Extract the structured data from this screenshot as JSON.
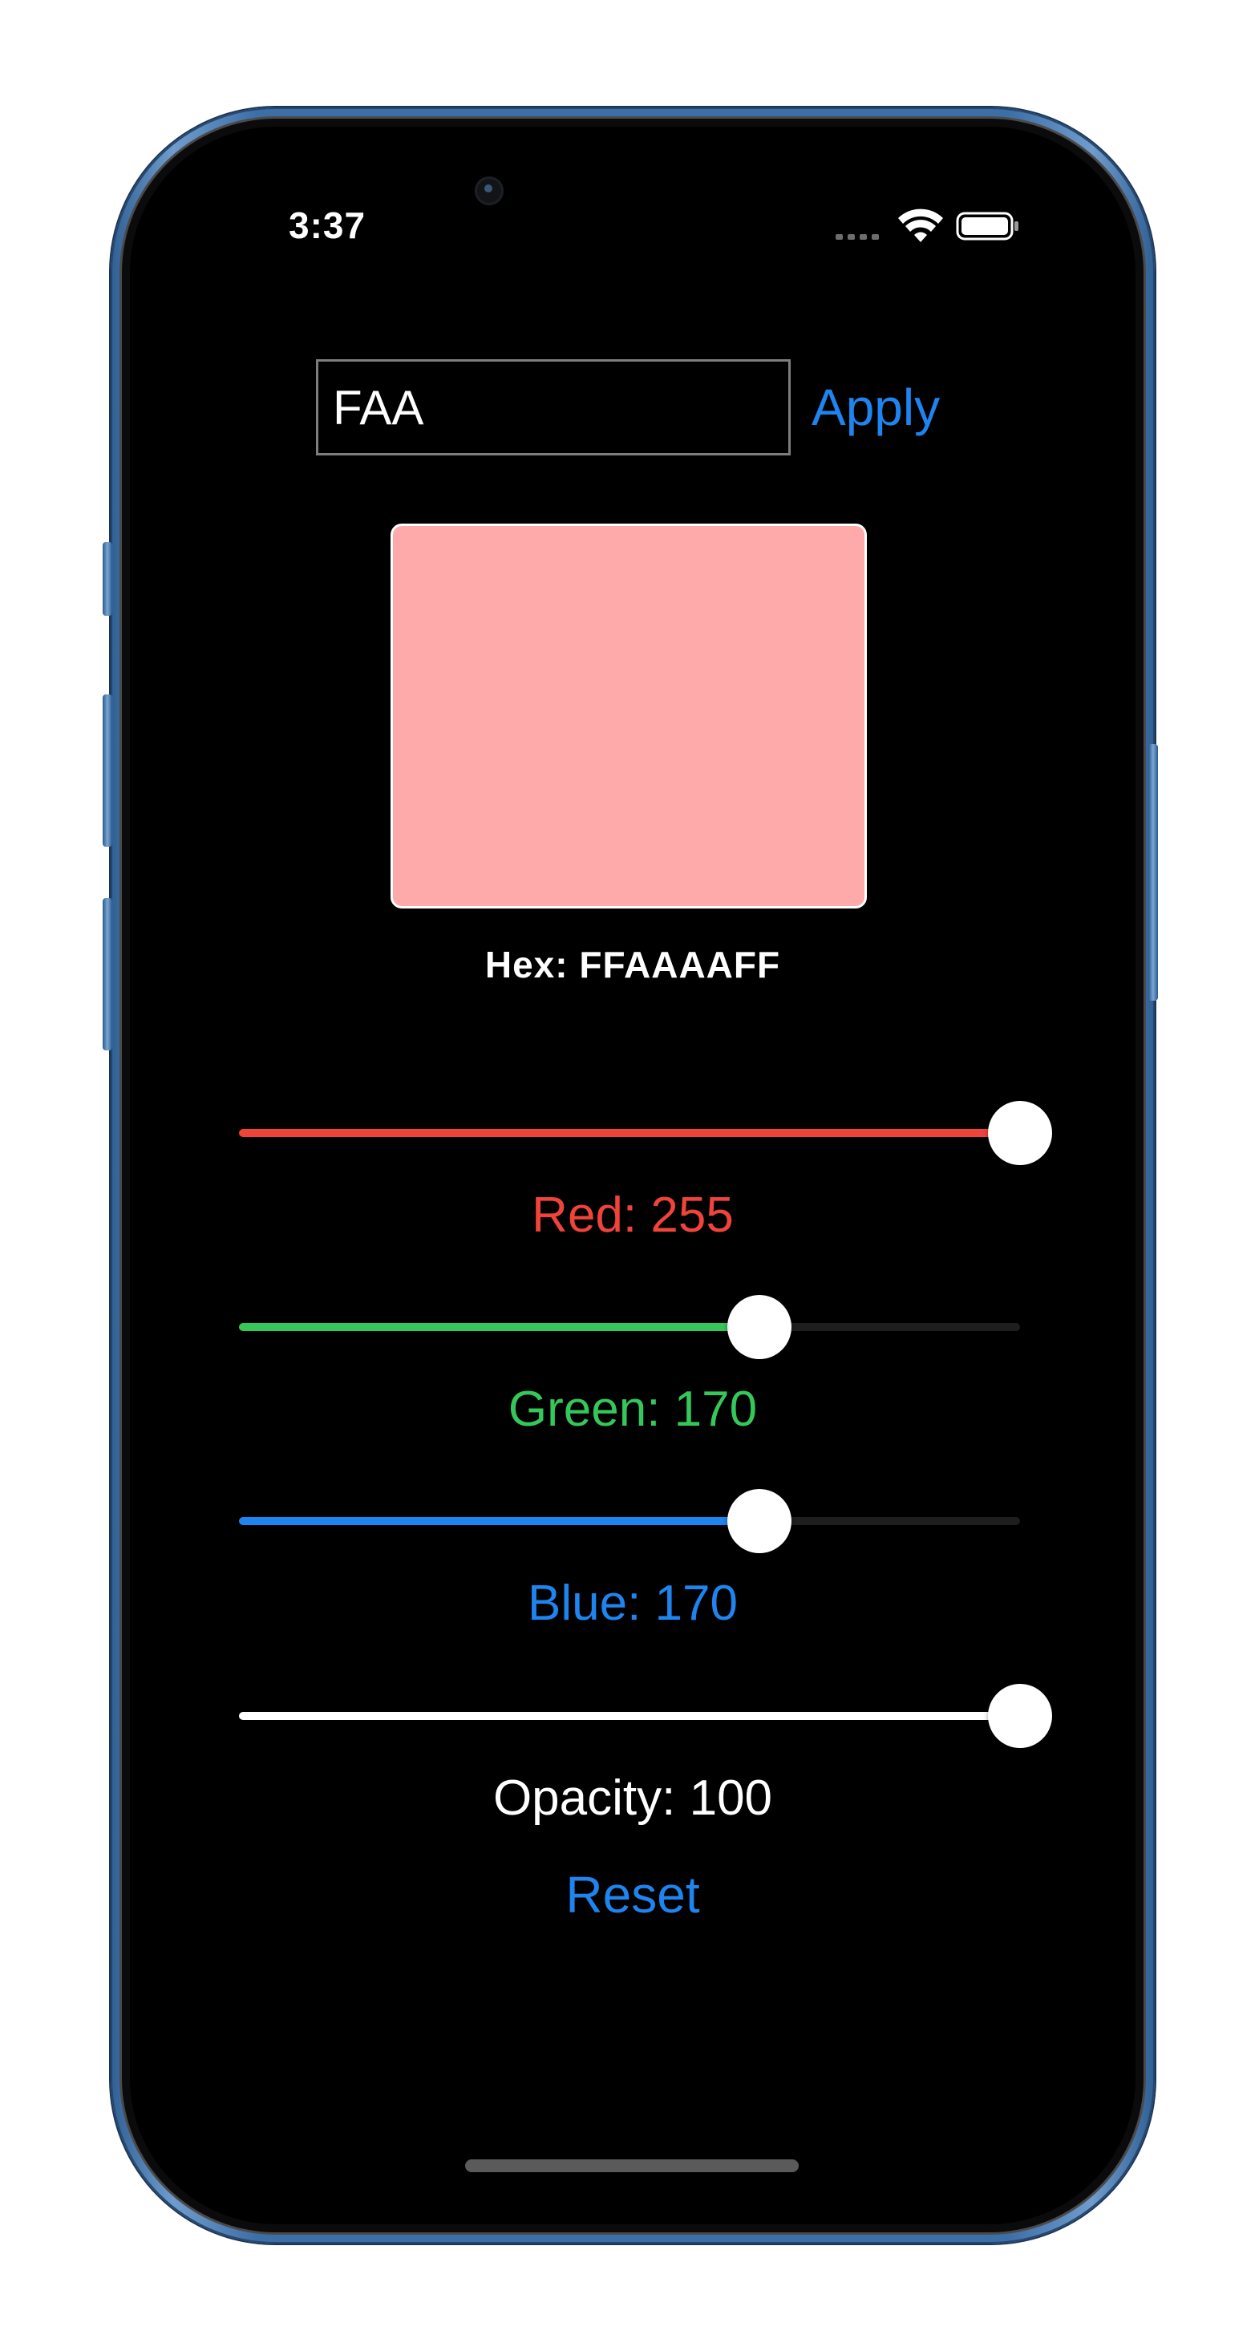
{
  "status": {
    "time": "3:37"
  },
  "hex_input": {
    "value": "FAA"
  },
  "apply_label": "Apply",
  "preview": {
    "color": "#FFAAAA"
  },
  "hex_display": "Hex: FFAAAAFF",
  "sliders": [
    {
      "label": "Red: 255",
      "value": 255,
      "max": 255,
      "fraction": 1.0,
      "color": "#f0433a"
    },
    {
      "label": "Green: 170",
      "value": 170,
      "max": 255,
      "fraction": 0.6667,
      "color": "#35c759"
    },
    {
      "label": "Blue: 170",
      "value": 170,
      "max": 255,
      "fraction": 0.6667,
      "color": "#1e84f0"
    },
    {
      "label": "Opacity: 100",
      "value": 100,
      "max": 100,
      "fraction": 1.0,
      "color": "#ffffff"
    }
  ],
  "reset_label": "Reset"
}
